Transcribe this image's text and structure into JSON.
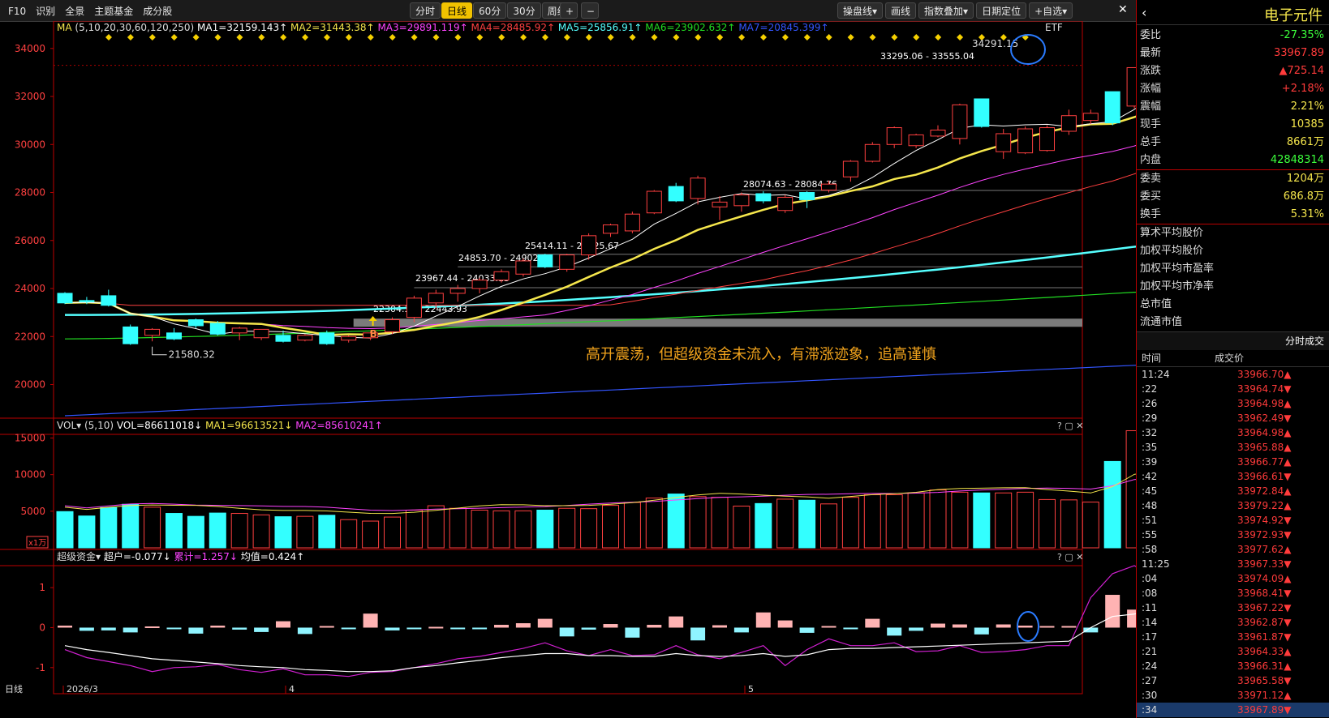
{
  "toolbar": {
    "left_items": [
      "F10",
      "识别",
      "全景",
      "主题基金",
      "成分股"
    ],
    "periods": [
      "分时",
      "日线",
      "60分",
      "30分",
      "周线▾"
    ],
    "active_period": "日线",
    "zoom_in": "+",
    "zoom_out": "−",
    "right_items": [
      "操盘线▾",
      "画线",
      "指数叠加▾",
      "日期定位",
      "+自选▾"
    ],
    "close": "✕"
  },
  "chart_data": [
    {
      "type": "candlestick",
      "title": "MA",
      "params": "(5,10,20,30,60,120,250)",
      "legend": [
        {
          "name": "MA1=32159.143↑",
          "color": "#ffffff"
        },
        {
          "name": "MA2=31443.38↑",
          "color": "#f5e64c"
        },
        {
          "name": "MA3=29891.119↑",
          "color": "#ff44ff"
        },
        {
          "name": "MA4=28485.92↑",
          "color": "#ff4040"
        },
        {
          "name": "MA5=25856.91↑",
          "color": "#55ffff"
        },
        {
          "name": "MA6=23902.632↑",
          "color": "#22dd22"
        },
        {
          "name": "MA7=20845.399↑",
          "color": "#3355ff"
        }
      ],
      "ylim": [
        18600,
        34600
      ],
      "yticks": [
        20000,
        22000,
        24000,
        26000,
        28000,
        30000,
        32000,
        34000
      ],
      "ohlc": [
        [
          23800,
          23850,
          23350,
          23400
        ],
        [
          23500,
          23650,
          23350,
          23450
        ],
        [
          23700,
          23950,
          23250,
          23300
        ],
        [
          22400,
          22500,
          21650,
          21700
        ],
        [
          22050,
          22350,
          21800,
          22300
        ],
        [
          22150,
          22350,
          21850,
          21900
        ],
        [
          22700,
          22750,
          22350,
          22450
        ],
        [
          22550,
          22650,
          22050,
          22100
        ],
        [
          22150,
          22400,
          21850,
          22350
        ],
        [
          21950,
          22300,
          21850,
          22300
        ],
        [
          22050,
          22250,
          21750,
          21800
        ],
        [
          21850,
          22100,
          21800,
          22050
        ],
        [
          22150,
          22250,
          21650,
          21700
        ],
        [
          21850,
          22050,
          21750,
          22000
        ],
        [
          21950,
          22200,
          21850,
          22150
        ],
        [
          22200,
          22800,
          22100,
          22700
        ],
        [
          22800,
          23700,
          22600,
          23600
        ],
        [
          23400,
          23950,
          23150,
          23800
        ],
        [
          23800,
          24150,
          23450,
          24000
        ],
        [
          24000,
          24450,
          23800,
          24350
        ],
        [
          24350,
          24800,
          24250,
          24700
        ],
        [
          24600,
          25250,
          24500,
          25150
        ],
        [
          25400,
          25450,
          24850,
          24900
        ],
        [
          24800,
          25450,
          24700,
          25400
        ],
        [
          25400,
          26300,
          25200,
          26200
        ],
        [
          26300,
          26700,
          26150,
          26650
        ],
        [
          26400,
          27200,
          26300,
          27100
        ],
        [
          27150,
          28100,
          27100,
          28050
        ],
        [
          28250,
          28400,
          27600,
          27650
        ],
        [
          27750,
          28700,
          27500,
          28600
        ],
        [
          27400,
          27850,
          26850,
          27600
        ],
        [
          27450,
          28000,
          27200,
          27900
        ],
        [
          27950,
          28050,
          27550,
          27650
        ],
        [
          27250,
          27900,
          27150,
          27800
        ],
        [
          28000,
          28050,
          27350,
          27700
        ],
        [
          28100,
          28500,
          28000,
          28350
        ],
        [
          28650,
          29350,
          28450,
          29300
        ],
        [
          29300,
          30100,
          29250,
          30000
        ],
        [
          30000,
          30750,
          29850,
          30700
        ],
        [
          29950,
          30450,
          29850,
          30400
        ],
        [
          30350,
          30800,
          30300,
          30600
        ],
        [
          30250,
          31700,
          30000,
          31650
        ],
        [
          31900,
          31900,
          30700,
          30750
        ],
        [
          29700,
          30650,
          29400,
          30450
        ],
        [
          29650,
          30750,
          29600,
          30650
        ],
        [
          29750,
          30800,
          29700,
          30700
        ],
        [
          30550,
          31450,
          30400,
          31200
        ],
        [
          31000,
          31450,
          30850,
          31300
        ],
        [
          32200,
          32200,
          30800,
          30900
        ],
        [
          31600,
          33200,
          31500,
          33200
        ],
        [
          34000,
          34250,
          33300,
          33800
        ]
      ],
      "annotations": [
        {
          "text": "34291.15",
          "type": "high"
        },
        {
          "text": "33295.06 - 33555.04",
          "type": "zone"
        },
        {
          "text": "28074.63 - 28084.76",
          "type": "zone"
        },
        {
          "text": "25414.11 - 25425.67",
          "type": "zone"
        },
        {
          "text": "24853.70 - 24902.56",
          "type": "zone"
        },
        {
          "text": "23967.44 - 24033.13",
          "type": "zone"
        },
        {
          "text": "22304.34 - 22443.93",
          "type": "zone"
        },
        {
          "text": "21580.32",
          "type": "low"
        },
        {
          "text": "B",
          "type": "signal"
        },
        {
          "text": "ETF",
          "type": "tag"
        }
      ],
      "comment": "高开震荡，但超级资金未流入，有滞涨迹象，追高谨慎"
    },
    {
      "type": "bar",
      "title": "VOL▾",
      "params": "(5,10)",
      "legend": [
        {
          "name": "VOL=86611018↓",
          "color": "#ffffff"
        },
        {
          "name": "MA1=96613521↓",
          "color": "#f5e64c"
        },
        {
          "name": "MA2=85610241↑",
          "color": "#ff44ff"
        }
      ],
      "ylim": [
        0,
        15500
      ],
      "yticks": [
        5000,
        10000,
        15000
      ],
      "unit": "x1万",
      "values": [
        4950,
        4350,
        5500,
        5950,
        5550,
        4700,
        4300,
        4750,
        4700,
        4500,
        4250,
        4300,
        4450,
        3850,
        3650,
        4200,
        5150,
        5750,
        5400,
        5150,
        5050,
        5050,
        5150,
        5400,
        5350,
        5800,
        6200,
        6800,
        7350,
        7000,
        6900,
        5700,
        6050,
        6650,
        6500,
        6000,
        6900,
        7250,
        7250,
        7500,
        7900,
        7600,
        7500,
        7500,
        7600,
        6600,
        6550,
        6250,
        11800,
        16000,
        8700
      ]
    },
    {
      "type": "bar",
      "title": "超级资金▾",
      "legend": [
        {
          "name": "超户=-0.077↓",
          "color": "#ffffff"
        },
        {
          "name": "累计=1.257↓",
          "color": "#ff44ff"
        },
        {
          "name": "均值=0.424↑",
          "color": "#ffffff"
        }
      ],
      "ylim": [
        -1.45,
        1.55
      ],
      "yticks": [
        -1,
        0,
        1
      ],
      "values": [
        0.05,
        -0.08,
        -0.07,
        -0.12,
        0.03,
        -0.03,
        -0.15,
        0.05,
        -0.05,
        -0.11,
        0.16,
        -0.16,
        0.04,
        -0.03,
        0.35,
        -0.07,
        -0.03,
        0.02,
        -0.03,
        -0.03,
        0.07,
        0.11,
        0.22,
        -0.22,
        -0.05,
        0.09,
        -0.25,
        0.07,
        0.28,
        -0.32,
        0.06,
        -0.12,
        0.38,
        0.18,
        -0.13,
        0.04,
        -0.04,
        0.22,
        -0.2,
        -0.08,
        0.1,
        0.08,
        -0.17,
        0.08,
        0.05,
        0.04,
        0.04,
        -0.12,
        0.82,
        0.45,
        -0.08
      ],
      "cum": [
        -0.55,
        -0.75,
        -0.85,
        -0.95,
        -1.1,
        -1.0,
        -0.98,
        -0.92,
        -1.05,
        -1.12,
        -1.03,
        -1.18,
        -1.18,
        -1.22,
        -1.12,
        -1.1,
        -1.0,
        -0.9,
        -0.78,
        -0.72,
        -0.62,
        -0.52,
        -0.38,
        -0.58,
        -0.7,
        -0.55,
        -0.7,
        -0.68,
        -0.45,
        -0.68,
        -0.78,
        -0.62,
        -0.45,
        -0.95,
        -0.55,
        -0.28,
        -0.45,
        -0.45,
        -0.38,
        -0.6,
        -0.58,
        -0.45,
        -0.62,
        -0.6,
        -0.55,
        -0.45,
        -0.45,
        0.75,
        1.35,
        1.55,
        1.26
      ],
      "avg": [
        -0.45,
        -0.55,
        -0.62,
        -0.7,
        -0.78,
        -0.82,
        -0.86,
        -0.9,
        -0.95,
        -0.98,
        -1.0,
        -1.05,
        -1.07,
        -1.1,
        -1.1,
        -1.08,
        -1.0,
        -0.95,
        -0.88,
        -0.82,
        -0.75,
        -0.7,
        -0.65,
        -0.65,
        -0.7,
        -0.7,
        -0.72,
        -0.72,
        -0.65,
        -0.7,
        -0.72,
        -0.7,
        -0.65,
        -0.72,
        -0.68,
        -0.55,
        -0.52,
        -0.52,
        -0.5,
        -0.48,
        -0.46,
        -0.44,
        -0.42,
        -0.4,
        -0.38,
        -0.36,
        -0.34,
        0.0,
        0.28,
        0.34,
        0.42
      ],
      "x_labels": [
        "2026/3",
        "4",
        "5"
      ],
      "footer": "日线"
    }
  ],
  "sidebar": {
    "title": "电子元件",
    "quote": [
      {
        "label": "委比",
        "value": "-27.35%",
        "color": "#3cff3c"
      },
      {
        "label": "最新",
        "value": "33967.89",
        "color": "#ff3b3b"
      },
      {
        "label": "涨跌",
        "value": "▲725.14",
        "color": "#ff3b3b"
      },
      {
        "label": "涨幅",
        "value": "+2.18%",
        "color": "#ff3b3b"
      },
      {
        "label": "震幅",
        "value": "2.21%",
        "color": "#f5e64c"
      },
      {
        "label": "现手",
        "value": "10385",
        "color": "#f5e64c"
      },
      {
        "label": "总手",
        "value": "8661万",
        "color": "#f5e64c"
      },
      {
        "label": "内盘",
        "value": "42848314",
        "color": "#3cff3c"
      }
    ],
    "orders": [
      {
        "label": "委卖",
        "value": "1204万",
        "color": "#f5e64c"
      },
      {
        "label": "委买",
        "value": "686.8万",
        "color": "#f5e64c"
      },
      {
        "label": "换手",
        "value": "5.31%",
        "color": "#f5e64c"
      }
    ],
    "links": [
      "算术平均股价",
      "加权平均股价",
      "加权平均市盈率",
      "加权平均市净率",
      "总市值",
      "流通市值"
    ],
    "ticks_header": "分时成交",
    "ticks_cols": [
      "时间",
      "成交价"
    ],
    "ticks": [
      [
        "11:24",
        "33966.70▲"
      ],
      [
        ":22",
        "33964.74▼"
      ],
      [
        ":26",
        "33964.98▲"
      ],
      [
        ":29",
        "33962.49▼"
      ],
      [
        ":32",
        "33964.98▲"
      ],
      [
        ":35",
        "33965.88▲"
      ],
      [
        ":39",
        "33966.77▲"
      ],
      [
        ":42",
        "33966.61▼"
      ],
      [
        ":45",
        "33972.84▲"
      ],
      [
        ":48",
        "33979.22▲"
      ],
      [
        ":51",
        "33974.92▼"
      ],
      [
        ":55",
        "33972.93▼"
      ],
      [
        ":58",
        "33977.62▲"
      ],
      [
        "11:25",
        "33967.33▼"
      ],
      [
        ":04",
        "33974.09▲"
      ],
      [
        ":08",
        "33968.41▼"
      ],
      [
        ":11",
        "33967.22▼"
      ],
      [
        ":14",
        "33962.87▼"
      ],
      [
        ":17",
        "33961.87▼"
      ],
      [
        ":21",
        "33964.33▲"
      ],
      [
        ":24",
        "33966.31▲"
      ],
      [
        ":27",
        "33965.58▼"
      ],
      [
        ":30",
        "33971.12▲"
      ],
      [
        ":34",
        "33967.89▼"
      ]
    ]
  }
}
